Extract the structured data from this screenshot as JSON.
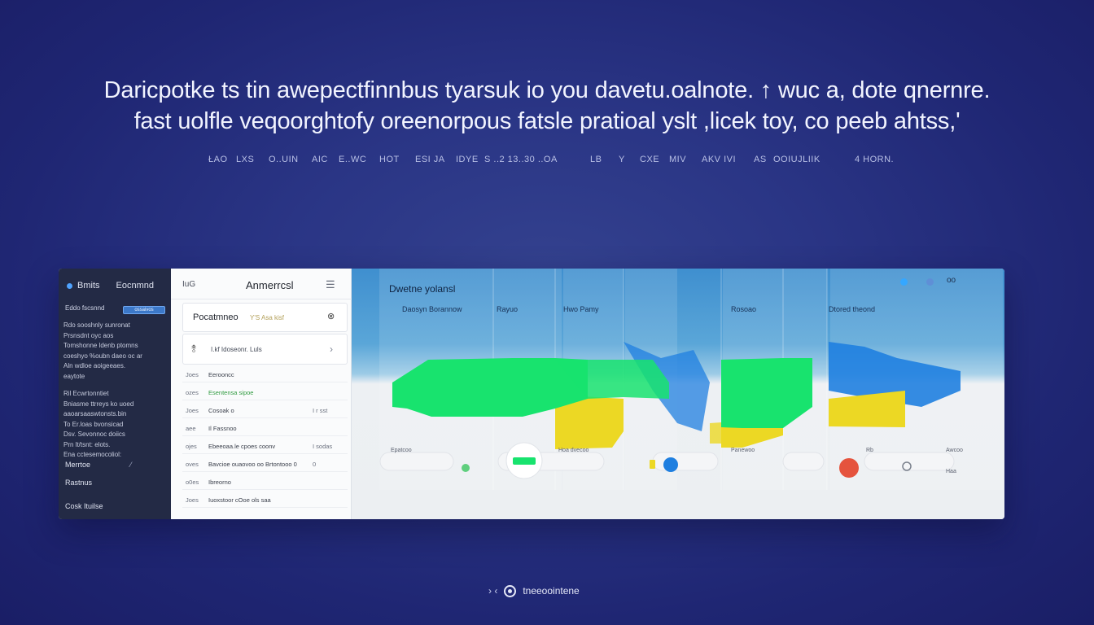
{
  "headline": {
    "line1": "Daricpotke ts tin awepectfinnbus tyarsuk io you davetu.oalnote. ↑ wuc a, dote qnernre.",
    "line2": "fast uolfle veqoorghtofy oreenorpous fatsle pratioal yslt ,licek toy, co peeb ahtss,'"
  },
  "meta_row": [
    "ŁAO",
    "LXS",
    "O..UIN",
    "AIC",
    "E..WC",
    "HOT",
    "ESI JA",
    "IDYE",
    "S ..2 13..30 ..OA",
    "LB",
    "Y",
    "CXE",
    "MIV",
    "AKV IVI",
    "AS",
    "OOIUJLIIK",
    "4 HORN."
  ],
  "sidebar": {
    "brand": "Bmits",
    "title": "Eocnmnd",
    "filter_label": "Eddo fscsnnd",
    "filter_pill": "ossaivos",
    "text_block_1": [
      "Rdo sooshnly sunronat",
      "Prsnsdnt oyc aos",
      "Tomshonne ldenb ptomns",
      "coeshyo %oubn daeo oc ar",
      "Aln wdloe aoigeeaes.",
      "eaytote"
    ],
    "text_block_2": [
      "Ril Ecwrtonntiet",
      "Bniasme ttrreys ko uoed",
      "aaoarsaaswtonsts.bin",
      "To Er.loas  bvonsicad",
      "Dsv. Sevonnoc doiics",
      "Prn lt/tsnt: elots.",
      "Ena cctesemocoliol:"
    ],
    "item_1": "Merrtoe",
    "item_2": "Rastnus",
    "item_3": "Cosk Ituilse"
  },
  "panel": {
    "label": "IuG",
    "title": "Anmerrcsl",
    "card1_title": "Pocatmneo",
    "card1_sub": "Y'S  Asa  kisf",
    "card2_text": "I.kf Idoseonr.  Luls",
    "rows": [
      {
        "k": "Joes",
        "v": "Eerooncc",
        "x": "",
        "green": false
      },
      {
        "k": "ozes",
        "v": "Esentensa sipoe",
        "x": "",
        "green": true
      },
      {
        "k": "Joes",
        "v": "Cosoak o",
        "x": "I  r  sst",
        "green": false
      },
      {
        "k": "aee",
        "v": "Il Fassnoo",
        "x": "",
        "green": false
      },
      {
        "k": "ojes",
        "v": "Ebeeoaa.le  cpoes coonv",
        "x": "I  sodas",
        "green": false
      },
      {
        "k": "oves",
        "v": "Bavcioe  ouaovoo oo  Brtontooo  0",
        "x": "0",
        "green": false
      },
      {
        "k": "o0es",
        "v": "Ibreorno",
        "x": "",
        "green": false
      },
      {
        "k": "Joes",
        "v": "Iuoxstoor cOoe ols saa",
        "x": "",
        "green": false
      }
    ]
  },
  "viz": {
    "title": "Dwetne yolansl",
    "col_labels": [
      "Daosyn Borannow",
      "Rayuo",
      "Hwo Pamy",
      "Rosoao",
      "Dtored theond"
    ],
    "more": "oo",
    "bottom_labels": [
      "Epatcoo",
      "Hoa dvecoo",
      "Panewoo",
      "Rb",
      "Awcoo",
      "Haa"
    ],
    "colors": {
      "green": "#18e36e",
      "yellow": "#ecd824",
      "blue": "#1f7fe0",
      "red": "#e5533d"
    }
  },
  "chart_data": {
    "type": "area",
    "title": "Dwetne yolansl",
    "categories": [
      "Daosyn Borannow",
      "Rayuo",
      "Hwo Pamy",
      "Rosoao",
      "Dtored theond"
    ],
    "series": [
      {
        "values": [
          0.55,
          0.6,
          0.55,
          0.65,
          0.1
        ]
      },
      {
        "values": [
          0.15,
          0.25,
          0.3,
          0.2,
          0.25
        ]
      },
      {
        "values": [
          0.0,
          0.1,
          0.5,
          0.1,
          0.55
        ]
      }
    ]
  },
  "footer": {
    "mark": "›  ‹",
    "brand": "tneeoointene"
  }
}
